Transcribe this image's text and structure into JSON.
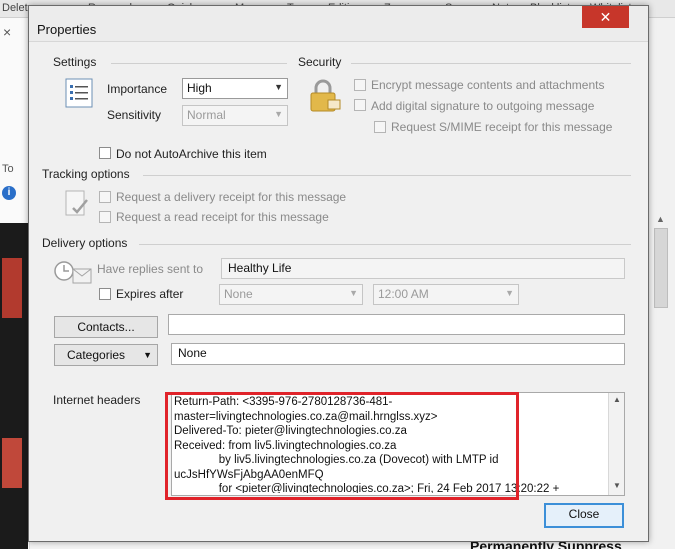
{
  "background": {
    "ribbon_tabs": [
      "Delete",
      "Respond",
      "Quick",
      "Move",
      "Tags",
      "Editing",
      "Zoom",
      "Spam",
      "Not",
      "Blocklist",
      "Whitelist"
    ],
    "left_to_label": "To",
    "bottom_text": "Permanently Suppress"
  },
  "dialog": {
    "title": "Properties",
    "close_glyph": "✕",
    "settings": {
      "section_label": "Settings",
      "importance_label": "Importance",
      "importance_value": "High",
      "sensitivity_label": "Sensitivity",
      "sensitivity_value": "Normal",
      "autoarchive_label": "Do not AutoArchive this item"
    },
    "security": {
      "section_label": "Security",
      "encrypt_label": "Encrypt message contents and attachments",
      "signature_label": "Add digital signature to outgoing message",
      "smime_label": "Request S/MIME receipt for this message"
    },
    "tracking": {
      "section_label": "Tracking options",
      "delivery_receipt_label": "Request a delivery receipt for this message",
      "read_receipt_label": "Request a read receipt for this message"
    },
    "delivery": {
      "section_label": "Delivery options",
      "replies_label": "Have replies sent to",
      "replies_value": "Healthy Life",
      "expires_label": "Expires after",
      "expires_date": "None",
      "expires_time": "12:00 AM"
    },
    "contacts_button": "Contacts...",
    "contacts_value": "",
    "categories_button": "Categories",
    "categories_value": "None",
    "internet_headers_label": "Internet headers",
    "internet_headers_text": "Return-Path: <3395-976-2780128736-481-\nmaster=livingtechnologies.co.za@mail.hrnglss.xyz>\nDelivered-To: pieter@livingtechnologies.co.za\nReceived: from liv5.livingtechnologies.co.za\n              by liv5.livingtechnologies.co.za (Dovecot) with LMTP id\nucJsHfYWsFjAbgAA0enMFQ\n              for <pieter@livingtechnologies.co.za>; Fri, 24 Feb 2017 13:20:22 +",
    "close_button": "Close"
  }
}
